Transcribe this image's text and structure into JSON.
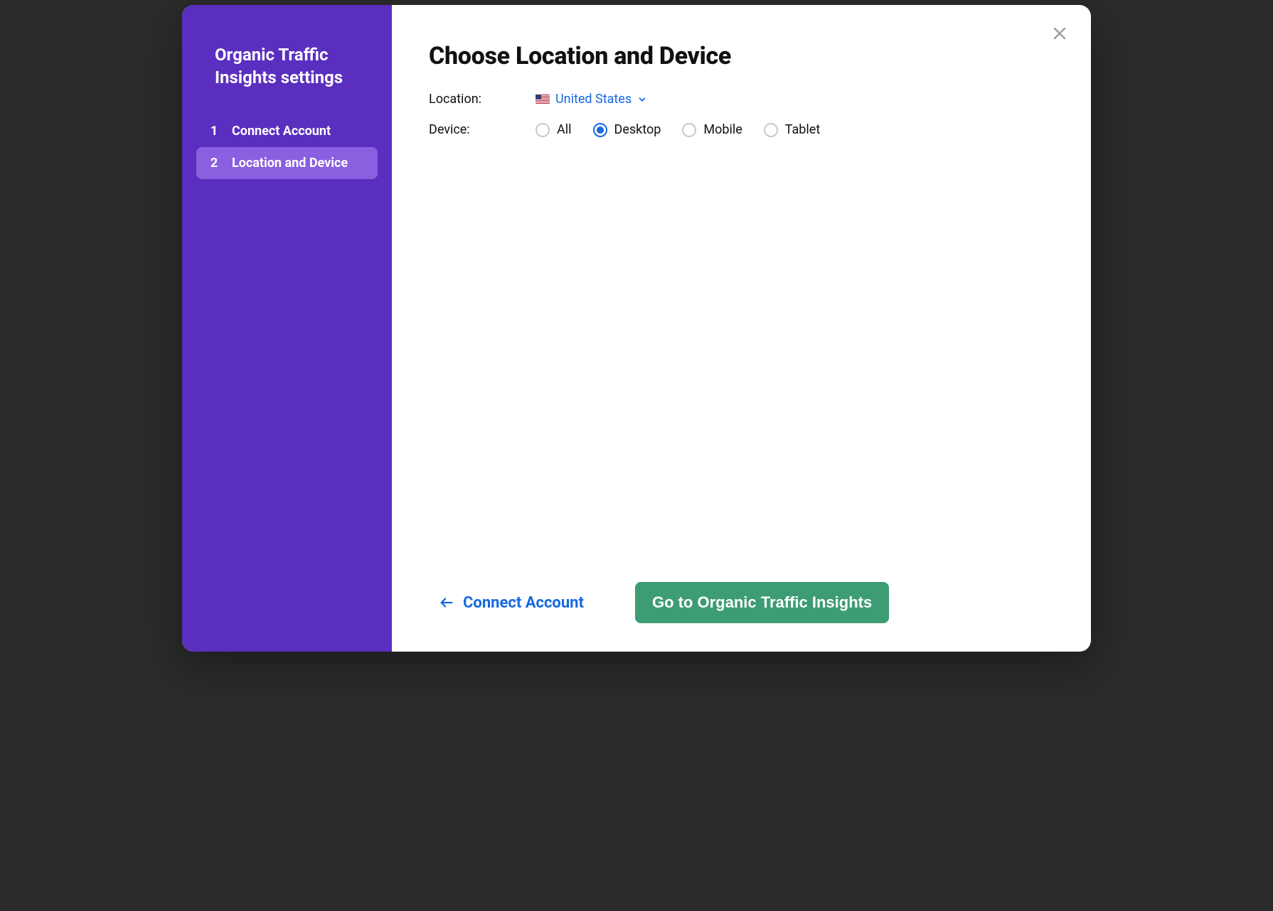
{
  "sidebar": {
    "title": "Organic Traffic Insights settings",
    "steps": [
      {
        "num": "1",
        "label": "Connect Account",
        "active": false
      },
      {
        "num": "2",
        "label": "Location and Device",
        "active": true
      }
    ]
  },
  "main": {
    "title": "Choose Location and Device",
    "location_label": "Location:",
    "location_value": "United States",
    "device_label": "Device:",
    "device_options": [
      {
        "key": "all",
        "label": "All",
        "selected": false
      },
      {
        "key": "desktop",
        "label": "Desktop",
        "selected": true
      },
      {
        "key": "mobile",
        "label": "Mobile",
        "selected": false
      },
      {
        "key": "tablet",
        "label": "Tablet",
        "selected": false
      }
    ]
  },
  "footer": {
    "back_label": "Connect Account",
    "primary_label": "Go to Organic Traffic Insights"
  },
  "colors": {
    "sidebar_bg": "#5a2fbf",
    "sidebar_active_bg": "#8a5fe0",
    "link_blue": "#1669e0",
    "primary_green": "#3d9c73"
  }
}
